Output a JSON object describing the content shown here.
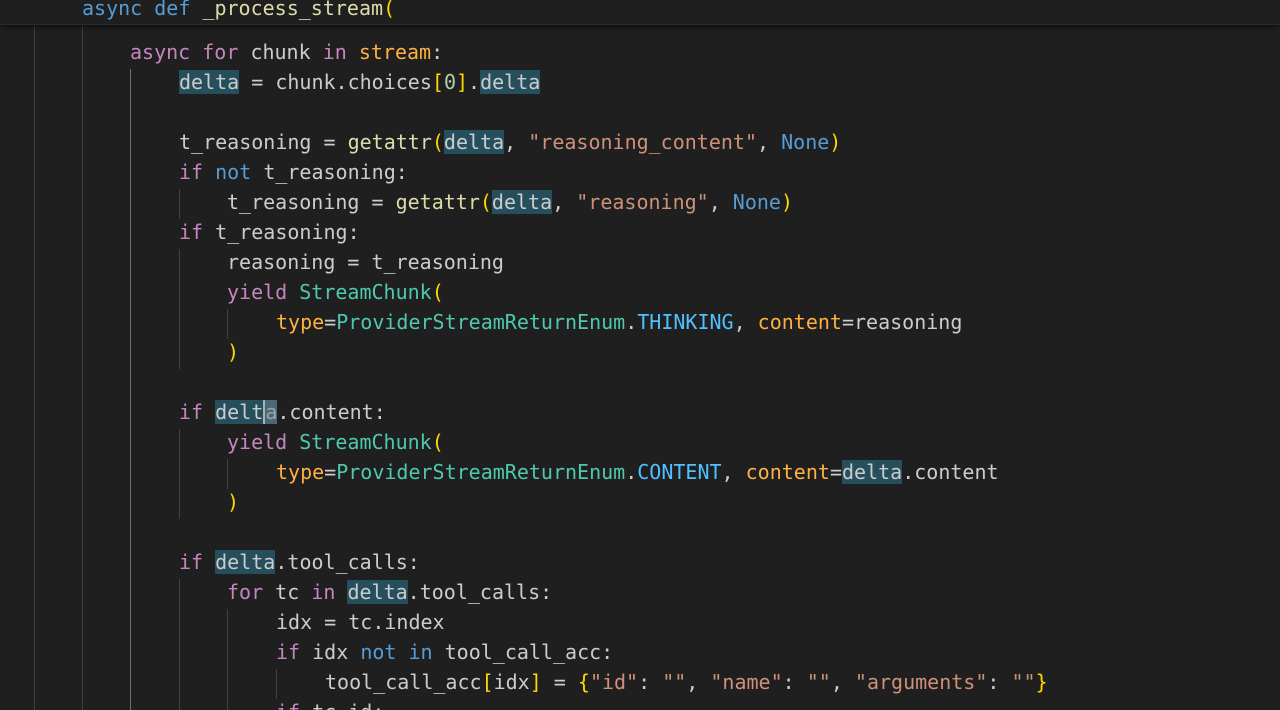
{
  "sticky_header": {
    "keyword_async": "async",
    "keyword_def": "def",
    "function_name": "_process_stream",
    "open_paren": "("
  },
  "code": {
    "l1": {
      "kw_async": "async",
      "kw_for": "for",
      "var_chunk": "chunk",
      "kw_in": "in",
      "var_stream": "stream",
      "colon": ":"
    },
    "l2": {
      "var_delta": "delta",
      "op": " = ",
      "text_a": "chunk.choices",
      "lbr": "[",
      "num": "0",
      "rbr": "]",
      "dot": ".",
      "attr_delta": "delta"
    },
    "l4": {
      "var": "t_reasoning",
      "op": " = ",
      "fn": "getattr",
      "lp": "(",
      "arg": "delta",
      "sep": ", ",
      "str": "\"reasoning_content\"",
      "sep2": ", ",
      "none": "None",
      "rp": ")"
    },
    "l5": {
      "kw_if": "if",
      "kw_not": "not",
      "var": "t_reasoning",
      "colon": ":"
    },
    "l6": {
      "var": "t_reasoning",
      "op": " = ",
      "fn": "getattr",
      "lp": "(",
      "arg": "delta",
      "sep": ", ",
      "str": "\"reasoning\"",
      "sep2": ", ",
      "none": "None",
      "rp": ")"
    },
    "l7": {
      "kw_if": "if",
      "var": "t_reasoning",
      "colon": ":"
    },
    "l8": {
      "text": "reasoning = t_reasoning"
    },
    "l9": {
      "kw_yield": "yield",
      "cls": "StreamChunk",
      "lp": "("
    },
    "l10": {
      "kw1": "type",
      "eq1": "=",
      "cls": "ProviderStreamReturnEnum",
      "dot": ".",
      "const": "THINKING",
      "sep": ", ",
      "kw2": "content",
      "eq2": "=",
      "val": "reasoning"
    },
    "l11": {
      "rp": ")"
    },
    "l13": {
      "kw_if": "if",
      "var_a": "delt",
      "var_b": "a",
      "rest": ".content:"
    },
    "l14": {
      "kw_yield": "yield",
      "cls": "StreamChunk",
      "lp": "("
    },
    "l15": {
      "kw1": "type",
      "eq1": "=",
      "cls": "ProviderStreamReturnEnum",
      "dot": ".",
      "const": "CONTENT",
      "sep": ", ",
      "kw2": "content",
      "eq2": "=",
      "var": "delta",
      "rest": ".content"
    },
    "l16": {
      "rp": ")"
    },
    "l18": {
      "kw_if": "if",
      "var": "delta",
      "rest": ".tool_calls:"
    },
    "l19": {
      "kw_for": "for",
      "var_tc": "tc",
      "kw_in": "in",
      "var": "delta",
      "rest": ".tool_calls:"
    },
    "l20": {
      "text": "idx = tc.index"
    },
    "l21": {
      "kw_if": "if",
      "var": "idx",
      "kw_not": "not",
      "kw_in": "in",
      "rest": "tool_call_acc:"
    },
    "l22": {
      "var": "tool_call_acc",
      "lbr": "[",
      "idx": "idx",
      "rbr": "]",
      "op": " = ",
      "lb": "{",
      "s1": "\"id\"",
      "c1": ": ",
      "s2": "\"\"",
      "sep1": ", ",
      "s3": "\"name\"",
      "c2": ": ",
      "s4": "\"\"",
      "sep2": ", ",
      "s5": "\"arguments\"",
      "c3": ": ",
      "s6": "\"\"",
      "rb": "}"
    },
    "l23": {
      "kw_if": "if",
      "rest": "tc.id:"
    }
  },
  "colors": {
    "background": "#1f1f1f",
    "keyword": "#c586c0",
    "builtin": "#569cd6",
    "function": "#dcdcaa",
    "string": "#ce9178",
    "class": "#4ec9b0",
    "constant": "#4fc1ff",
    "parameter": "#9cdcfe",
    "bracket_1": "#ffd700",
    "bracket_2": "#da70d6",
    "bracket_3": "#179fff",
    "highlight": "#264f5e"
  }
}
